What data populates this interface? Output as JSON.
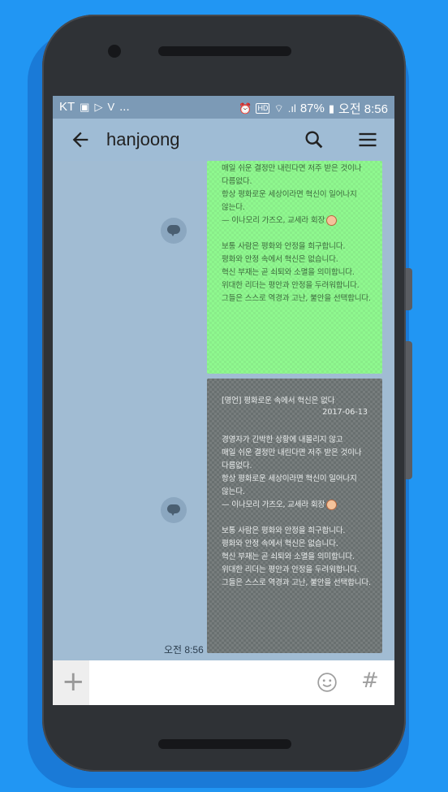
{
  "status_bar": {
    "carrier": "KT",
    "more": "...",
    "signal_label": ".ıl",
    "hd_label": "HD",
    "battery": "87%",
    "time": "오전 8:56"
  },
  "app_bar": {
    "title": "hanjoong"
  },
  "chat": {
    "messages": [
      {
        "lines": "매일 쉬운 결정만 내린다면 저주 받은 것이나\n다름없다.\n항상 평화로운 세상이라면 혁신이 일어나지\n않는다.\n— 이나모리 가즈오, 교세라 회장",
        "lines2": "보통 사람은 평화와 안정을 희구합니다.\n평화와 안정 속에서 혁신은 없습니다.\n혁신 부재는 곧 쇠퇴와 소멸을 의미합니다.\n위대한 리더는 평안과 안정을 두려워합니다.\n그들은 스스로 역경과 고난, 불안을 선택합니다."
      },
      {
        "heading": "[명언] 평화로운 속에서 혁신은 없다",
        "date": "2017-06-13",
        "lines": "경영자가 긴박한 상황에 내몰리지 않고\n매일 쉬운 결정만 내린다면 저주 받은 것이나\n다름없다.\n항상 평화로운 세상이라면 혁신이 일어나지\n않는다.\n— 이나모리 가즈오, 교세라 회장",
        "lines2": "보통 사람은 평화와 안정을 희구합니다.\n평화와 안정 속에서 혁신은 없습니다.\n혁신 부재는 곧 쇠퇴와 소멸을 의미합니다.\n위대한 리더는 평안과 안정을 두려워합니다.\n그들은 스스로 역경과 고난, 불안을 선택합니다.",
        "time": "오전 8:56"
      }
    ]
  },
  "input_bar": {
    "plus_label": "+",
    "placeholder": "",
    "hash_label": "#"
  },
  "colors": {
    "background": "#2196f3",
    "chat_bg": "#a1bcd3",
    "app_bar": "#9fbcd5",
    "bubble_green": "#8ff88f",
    "bubble_gray": "#697070"
  },
  "icons": {
    "back": "arrow-left-icon",
    "search": "search-icon",
    "menu": "hamburger-menu-icon",
    "share": "speech-bubble-icon",
    "emoji": "smiley-icon"
  }
}
